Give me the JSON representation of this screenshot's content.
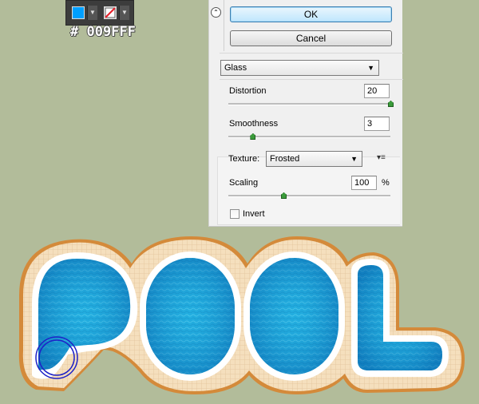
{
  "toolbar": {
    "fill_color": "#009FFF",
    "hex_label": "# 009FFF",
    "fill_swatch_icon": "fill-color-swatch",
    "stroke_swatch_icon": "no-stroke-swatch"
  },
  "dialog": {
    "ok_label": "OK",
    "cancel_label": "Cancel",
    "effect_select": "Glass",
    "distortion": {
      "label": "Distortion",
      "value": "20",
      "level": 1.0
    },
    "smoothness": {
      "label": "Smoothness",
      "value": "3",
      "level": 0.2
    },
    "texture": {
      "label": "Texture:",
      "value": "Frosted"
    },
    "scaling": {
      "label": "Scaling",
      "value": "100",
      "unit": "%",
      "level": 0.4
    },
    "invert": {
      "label": "Invert",
      "checked": false
    }
  },
  "artwork": {
    "text": "POOL",
    "water_color": "#1fa9dc",
    "tile_color": "#f3dcb8",
    "rim_color": "#d48a3a",
    "selection_circle_color": "#1e22c8"
  }
}
